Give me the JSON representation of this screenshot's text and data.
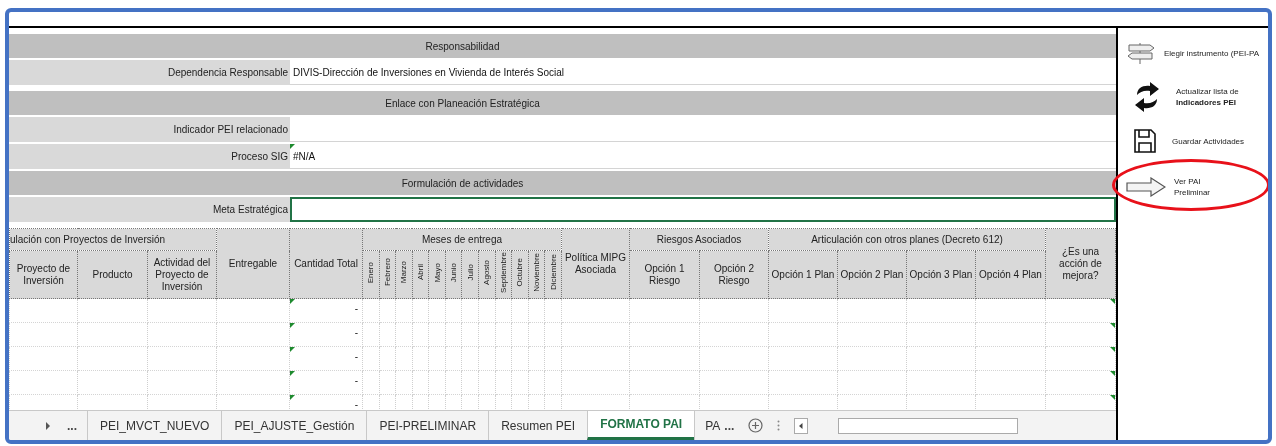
{
  "form": [
    {
      "kind": "header",
      "title": "Responsabilidad"
    },
    {
      "kind": "field",
      "label": "Dependencia Responsable",
      "value": "DIVIS-Dirección de Inversiones en Vivienda de Interés Social",
      "flagged": false,
      "selected": false
    },
    {
      "kind": "header",
      "title": "Enlace con Planeación Estratégica"
    },
    {
      "kind": "field",
      "label": "Indicador PEI relacionado",
      "flagged": false,
      "selected": false
    },
    {
      "kind": "field",
      "label": "Proceso SIG",
      "value": "#N/A",
      "flagged": true,
      "selected": false
    },
    {
      "kind": "header",
      "title": "Formulación de actividades"
    },
    {
      "kind": "field",
      "label": "Meta Estratégica",
      "flagged": false,
      "selected": true
    }
  ],
  "table": {
    "column_groups": [
      {
        "kind": "group",
        "title": "ulación con Proyectos de Inversión",
        "columns": [
          "Proyecto de Inversión",
          "Producto",
          "Actividad del Proyecto de Inversión"
        ]
      },
      {
        "kind": "single",
        "columns": [
          "Entregable"
        ]
      },
      {
        "kind": "single",
        "columns": [
          "Cantidad Total"
        ]
      },
      {
        "kind": "months",
        "title": "Meses de entrega",
        "columns": [
          "Enero",
          "Febrero",
          "Marzo",
          "Abril",
          "Mayo",
          "Junio",
          "Julio",
          "Agosto",
          "Septiembre",
          "Octubre",
          "Noviembre",
          "Diciembre"
        ]
      },
      {
        "kind": "single",
        "columns": [
          "Política MIPG Asociada"
        ]
      },
      {
        "kind": "group",
        "title": "Riesgos Asociados",
        "columns": [
          "Opción 1 Riesgo",
          "Opción 2 Riesgo"
        ]
      },
      {
        "kind": "group",
        "title": "Articulación con otros planes (Decreto 612)",
        "columns": [
          "Opción 1 Plan",
          "Opción 2 Plan",
          "Opción 3 Plan",
          "Opción 4 Plan"
        ]
      },
      {
        "kind": "single",
        "columns": [
          "¿Es una acción de mejora?"
        ]
      }
    ],
    "rows": [
      {
        "cantidad_total": "-",
        "flagged": true
      },
      {
        "cantidad_total": "-",
        "flagged": true
      },
      {
        "cantidad_total": "-",
        "flagged": true
      },
      {
        "cantidad_total": "-",
        "flagged": true
      },
      {
        "cantidad_total": "-",
        "flagged": true
      }
    ]
  },
  "actions": [
    {
      "kind": "signpost",
      "lines": [
        "Elegir instrumento (PEI-PA"
      ],
      "circled": false
    },
    {
      "kind": "refresh",
      "lines": [
        "Actualizar lista de",
        "Indicadores PEI"
      ],
      "circled": false
    },
    {
      "kind": "save",
      "lines": [
        "Guardar Actividades"
      ],
      "circled": false
    },
    {
      "kind": "arrow",
      "lines": [
        "Ver PAI",
        "Preliminar"
      ],
      "circled": true
    }
  ],
  "sheet_tabs": {
    "nav_left": "...",
    "tabs": [
      {
        "label": "PEI_MVCT_NUEVO",
        "selected": false
      },
      {
        "label": "PEI_AJUSTE_Gestión",
        "selected": false
      },
      {
        "label": "PEI-PRELIMINAR",
        "selected": false
      },
      {
        "label": "Resumen PEI",
        "selected": false
      },
      {
        "label": "FORMATO PAI",
        "selected": true
      },
      {
        "label": "PA",
        "selected": false
      }
    ],
    "nav_right": "..."
  }
}
